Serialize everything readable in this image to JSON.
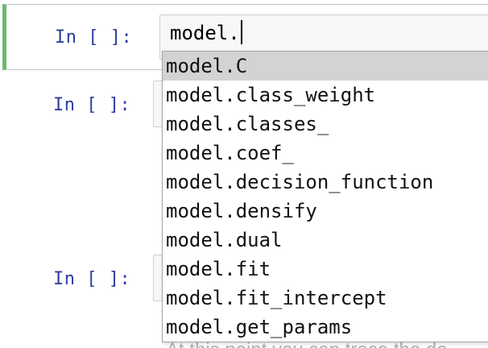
{
  "cells": [
    {
      "prompt": "In [ ]:",
      "input": "model."
    },
    {
      "prompt": "In [ ]:"
    },
    {
      "prompt": "In [ ]:"
    }
  ],
  "autocomplete": {
    "items": [
      "model.C",
      "model.class_weight",
      "model.classes_",
      "model.coef_",
      "model.decision_function",
      "model.densify",
      "model.dual",
      "model.fit",
      "model.fit_intercept",
      "model.get_params"
    ],
    "selected_index": 0
  },
  "markdown_below": "At this point you can trace the de",
  "colors": {
    "prompt": "#303f9f",
    "selected_cell_border": "#66bb6a",
    "dropdown_highlight": "#d3d3d3"
  }
}
